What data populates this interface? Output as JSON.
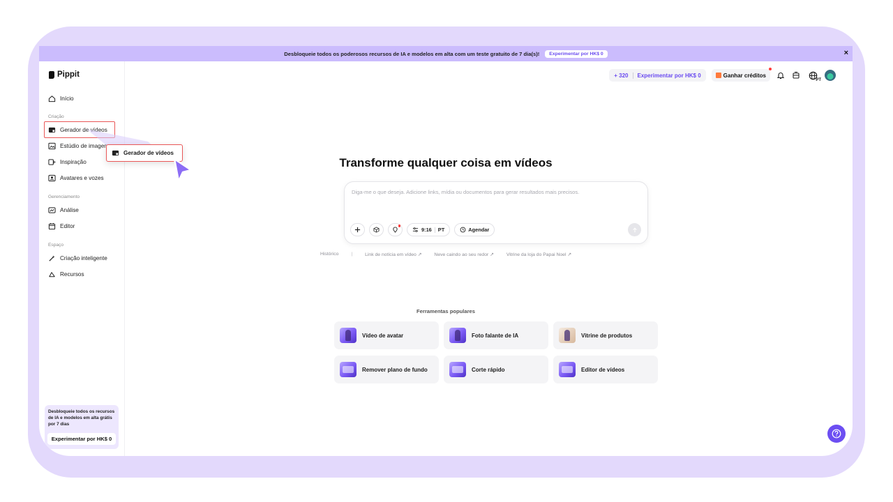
{
  "banner": {
    "text": "Desbloqueie todos os poderosos recursos de IA e modelos em alta com um teste gratuito de 7 dia(s)!",
    "cta": "Experimentar por HK$ 0",
    "close": "×"
  },
  "sidebar": {
    "brand": "Pippit",
    "home": "Início",
    "section_create": "Criação",
    "video_generator": "Gerador de vídeos",
    "image_studio": "Estúdio de imagem",
    "inspiration": "Inspiração",
    "avatars": "Avatares e vozes",
    "section_manage": "Gerenciamento",
    "analysis": "Análise",
    "editor": "Editor",
    "section_space": "Espaço",
    "smart_creation": "Criação inteligente",
    "resources": "Recursos",
    "promo_text": "Desbloqueie todos os recursos de IA e modelos em alta grátis por 7 dias",
    "promo_cta": "Experimentar por HK$ 0"
  },
  "topbar": {
    "credits": "+ 320",
    "try_cta": "Experimentar por HK$ 0",
    "earn": "Ganhar créditos",
    "language": "PT"
  },
  "main": {
    "title": "Transforme qualquer coisa em vídeos",
    "prompt_placeholder": "Diga-me o que deseja. Adicione links, mídia ou documentos para gerar resultados mais precisos.",
    "ratio": "9:16",
    "ratio_lang": "PT",
    "schedule": "Agendar",
    "suggestions": {
      "history": "Histórico",
      "divider": "|",
      "s1": "Link de notícia em vídeo ↗",
      "s2": "Neve caindo ao seu redor ↗",
      "s3": "Vitrine da loja do Papai Noel ↗"
    },
    "tools_title": "Ferramentas populares",
    "tools": [
      "Vídeo de avatar",
      "Foto falante de IA",
      "Vitrine de produtos",
      "Remover plano de fundo",
      "Corte rápido",
      "Editor de vídeos"
    ]
  },
  "popup": {
    "label": "Gerador de vídeos"
  },
  "colors": {
    "accent": "#6a4bf0",
    "frame": "#e3d9fc",
    "banner": "#cbbcfd",
    "highlight": "#e95757"
  }
}
